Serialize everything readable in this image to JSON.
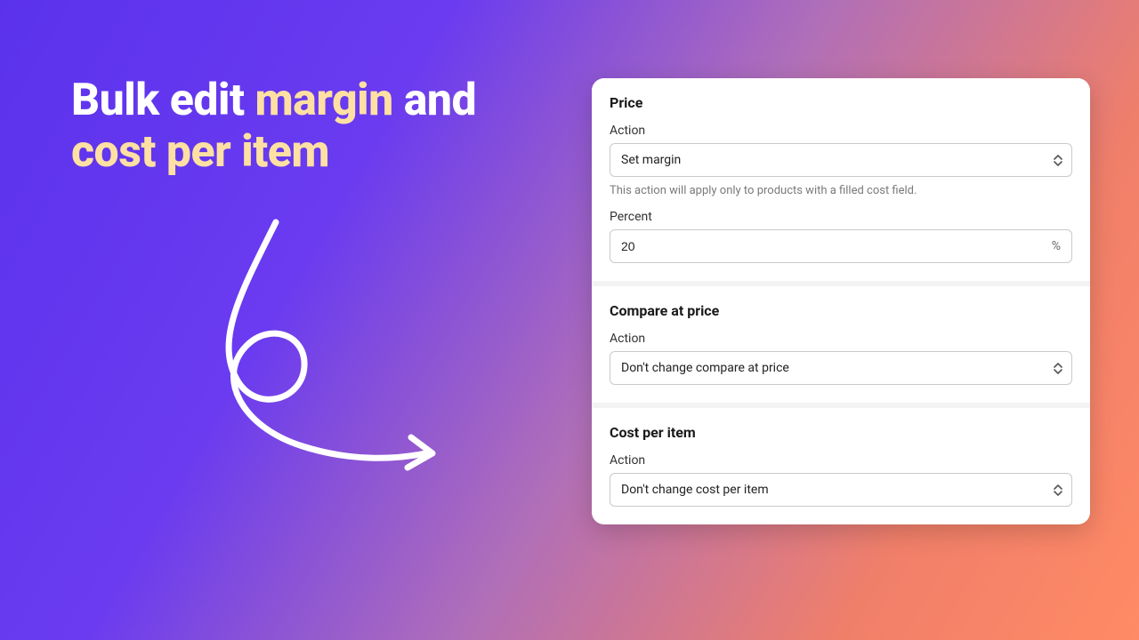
{
  "headline": {
    "part1": "Bulk edit ",
    "accent1": "margin",
    "part2": " and ",
    "accent2": "cost per item"
  },
  "panel": {
    "price": {
      "title": "Price",
      "action_label": "Action",
      "action_value": "Set margin",
      "help": "This action will apply only to products with a filled cost field.",
      "percent_label": "Percent",
      "percent_value": "20",
      "percent_suffix": "%"
    },
    "compare": {
      "title": "Compare at price",
      "action_label": "Action",
      "action_value": "Don't change compare at price"
    },
    "cost": {
      "title": "Cost per item",
      "action_label": "Action",
      "action_value": "Don't change cost per item"
    }
  }
}
